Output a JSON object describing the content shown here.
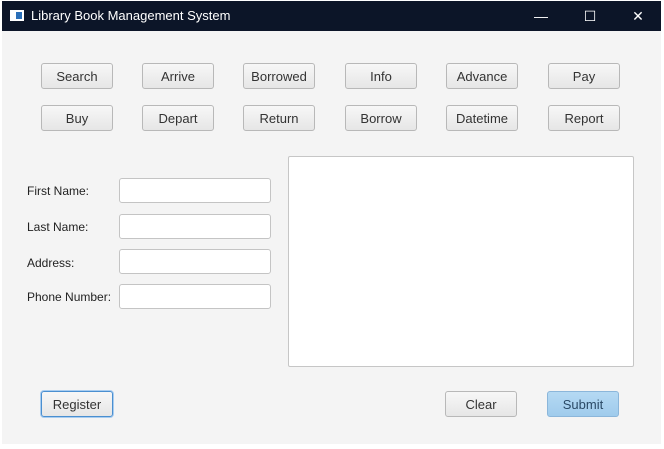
{
  "window": {
    "title": "Library Book Management System",
    "controls": {
      "minimize": "—",
      "maximize": "☐",
      "close": "✕"
    }
  },
  "toolbar": {
    "row1": [
      "Search",
      "Arrive",
      "Borrowed",
      "Info",
      "Advance",
      "Pay"
    ],
    "row2": [
      "Buy",
      "Depart",
      "Return",
      "Borrow",
      "Datetime",
      "Report"
    ]
  },
  "form": {
    "first_name_label": "First Name:",
    "last_name_label": "Last Name:",
    "address_label": "Address:",
    "phone_label": "Phone Number:",
    "first_name_value": "",
    "last_name_value": "",
    "address_value": "",
    "phone_value": ""
  },
  "output": {
    "text": ""
  },
  "actions": {
    "register": "Register",
    "clear": "Clear",
    "submit": "Submit"
  },
  "colors": {
    "titlebar": "#0c1528",
    "submit_bg": "#a8d2f0",
    "focus_border": "#4a8fd0"
  }
}
